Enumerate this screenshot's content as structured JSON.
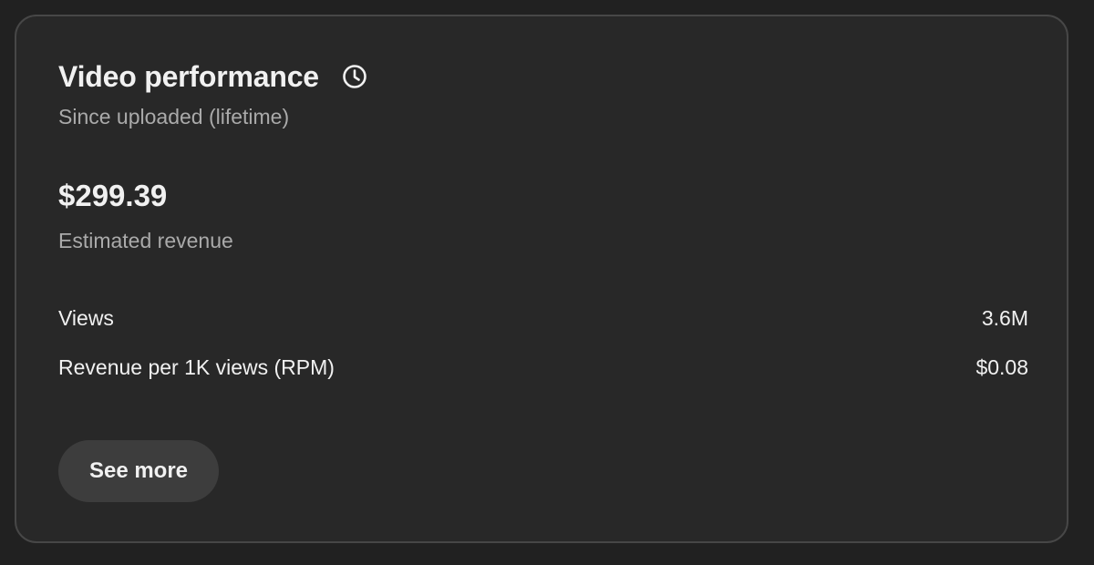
{
  "card": {
    "title": "Video performance",
    "title_icon": "clock-icon",
    "subtitle": "Since uploaded (lifetime)",
    "revenue": {
      "value": "$299.39",
      "label": "Estimated revenue"
    },
    "metrics": [
      {
        "label": "Views",
        "value": "3.6M"
      },
      {
        "label": "Revenue per 1K views (RPM)",
        "value": "$0.08"
      }
    ],
    "see_more_label": "See more"
  },
  "colors": {
    "page_background": "#212121",
    "card_background": "#282828",
    "card_border": "#474747",
    "primary_text": "#f1f1f1",
    "secondary_text": "#aaaaaa",
    "button_background": "#3d3d3d"
  }
}
